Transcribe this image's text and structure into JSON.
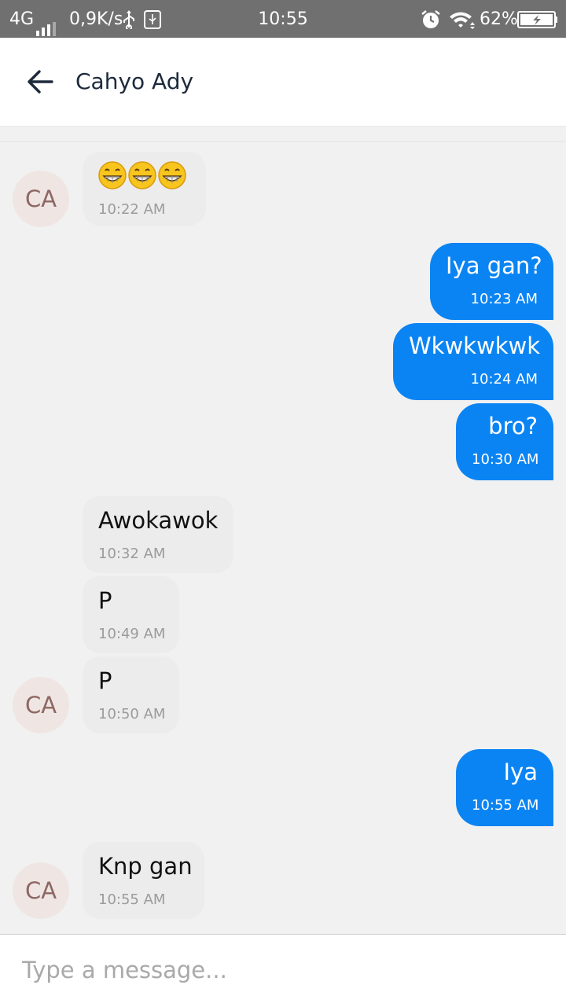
{
  "status_bar": {
    "network": "4G",
    "speed": "0,9K/s",
    "time": "10:55",
    "battery": "62%",
    "icons": [
      "signal-icon",
      "usb-icon",
      "usb-debug-icon",
      "alarm-icon",
      "wifi-icon",
      "battery-icon"
    ]
  },
  "header": {
    "title": "Cahyo Ady",
    "back_icon": "back-arrow-icon"
  },
  "messages": [
    {
      "direction": "in",
      "text": "😁😁😁",
      "time": "10:22 AM",
      "avatar": "CA"
    },
    {
      "direction": "out",
      "text": "Iya gan?",
      "time": "10:23 AM"
    },
    {
      "direction": "out",
      "text": "Wkwkwkwk",
      "time": "10:24 AM"
    },
    {
      "direction": "out",
      "text": "bro?",
      "time": "10:30 AM"
    },
    {
      "direction": "in",
      "text": "Awokawok",
      "time": "10:32 AM"
    },
    {
      "direction": "in",
      "text": "P",
      "time": "10:49 AM"
    },
    {
      "direction": "in",
      "text": "P",
      "time": "10:50 AM",
      "avatar": "CA"
    },
    {
      "direction": "out",
      "text": "Iya",
      "time": "10:55 AM"
    },
    {
      "direction": "in",
      "text": "Knp gan",
      "time": "10:55 AM",
      "avatar": "CA"
    }
  ],
  "composer": {
    "placeholder": "Type a message..."
  },
  "colors": {
    "outgoing_bubble": "#0b84f3",
    "incoming_bubble": "#ececec",
    "status_bar": "#707070",
    "background": "#f1f1f1"
  }
}
